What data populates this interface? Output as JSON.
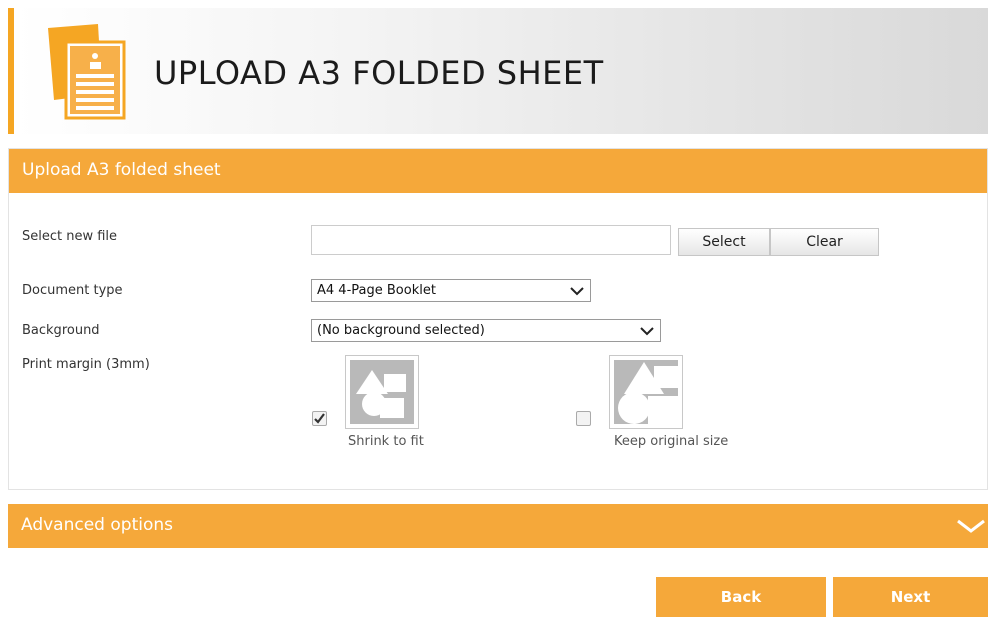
{
  "header": {
    "title": "UPLOAD A3 FOLDED SHEET",
    "icon": "document-stack-icon"
  },
  "form": {
    "section_title": "Upload A3 folded sheet",
    "file": {
      "label": "Select new file",
      "value": "",
      "select_label": "Select",
      "clear_label": "Clear"
    },
    "document_type": {
      "label": "Document type",
      "selected": "A4 4-Page Booklet"
    },
    "background": {
      "label": "Background",
      "selected": "(No background selected)"
    },
    "print_margin": {
      "label": "Print margin (3mm)",
      "options": [
        {
          "caption": "Shrink to fit",
          "checked": true,
          "icon": "shrink-to-fit-icon"
        },
        {
          "caption": "Keep original size",
          "checked": false,
          "icon": "keep-original-size-icon"
        }
      ]
    }
  },
  "advanced": {
    "label": "Advanced options",
    "expanded": false
  },
  "nav": {
    "back_label": "Back",
    "next_label": "Next"
  },
  "colors": {
    "accent": "#f5a83a",
    "header_accent": "#f5a623"
  }
}
